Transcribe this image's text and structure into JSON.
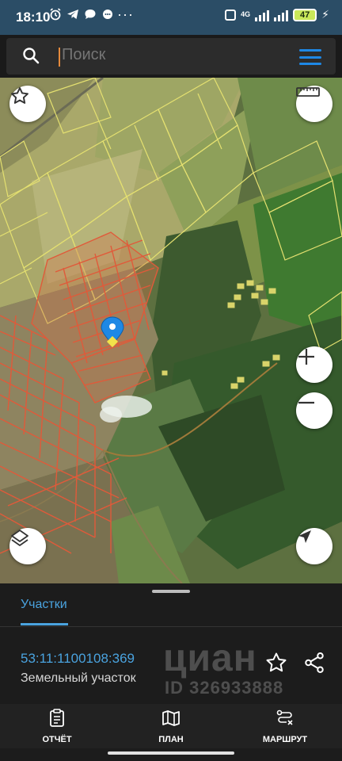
{
  "status_bar": {
    "time": "18:10",
    "network": "4G",
    "battery": "47",
    "dots": "···"
  },
  "search": {
    "placeholder": "Поиск",
    "value": ""
  },
  "map": {
    "buttons": [
      "star-icon",
      "ruler-icon",
      "zoom-in-icon",
      "zoom-out-icon",
      "layers-icon",
      "locate-icon"
    ],
    "colors": {
      "parcel_outline_yellow": "#e4e070",
      "parcel_outline_red": "#e05a3a",
      "marker": "#1e88e5"
    }
  },
  "panel": {
    "tab_label": "Участки",
    "parcel": {
      "number": "53:11:1100108:369",
      "type": "Земельный участок"
    },
    "watermark": {
      "logo": "циан",
      "id": "ID 326933888"
    }
  },
  "bottom_nav": {
    "report": "ОТЧЁТ",
    "plan": "ПЛАН",
    "route": "МАРШРУТ"
  },
  "colors": {
    "accent": "#4aa3df",
    "status_bar": "#2b4d66",
    "panel_bg": "#1c1c1c"
  }
}
